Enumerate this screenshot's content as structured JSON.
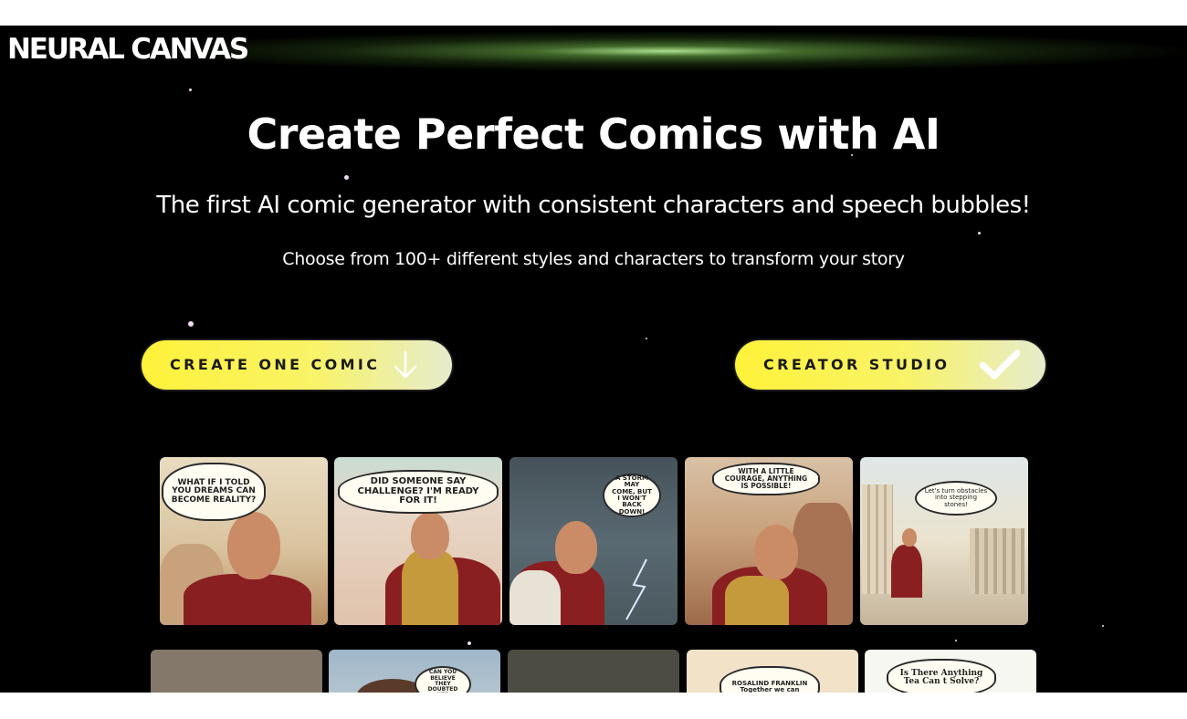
{
  "brand": {
    "logo": "NEURAL CANVAS"
  },
  "hero": {
    "title": "Create Perfect Comics with AI",
    "subtitle": "The first AI comic generator with consistent characters and speech bubbles!",
    "description": "Choose from 100+ different styles and characters to transform your story"
  },
  "actions": {
    "create_one": {
      "label": "CREATE ONE COMIC",
      "icon": "arrow-down-icon"
    },
    "studio": {
      "label": "CREATOR STUDIO",
      "icon": "checkmark-icon"
    }
  },
  "gallery_row1": [
    {
      "bubble": "WHAT IF I TOLD YOU DREAMS CAN BECOME REALITY?"
    },
    {
      "bubble": "DID SOMEONE SAY CHALLENGE? I'M READY FOR IT!"
    },
    {
      "bubble": "A STORM MAY COME, BUT I WON'T BACK DOWN!"
    },
    {
      "bubble": "WITH A LITTLE COURAGE, ANYTHING IS POSSIBLE!"
    },
    {
      "bubble": "Let's turn obstacles into stepping stones!"
    }
  ],
  "gallery_row2": [
    {
      "bubble": ""
    },
    {
      "bubble": "CAN YOU BELIEVE THEY DOUBTED HER"
    },
    {
      "bubble": ""
    },
    {
      "bubble": "ROSALIND FRANKLIN Together we can"
    },
    {
      "bubble": "Is There Anything Tea Can t Solve?"
    }
  ],
  "colors": {
    "background": "#000000",
    "cta_yellow": "#fff23a",
    "glow_green": "#b4eb96"
  }
}
